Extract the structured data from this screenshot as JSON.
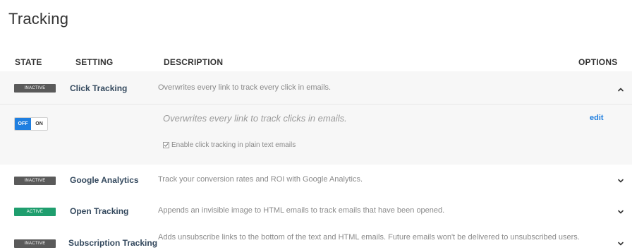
{
  "page": {
    "title": "Tracking"
  },
  "table": {
    "headers": {
      "state": "STATE",
      "setting": "SETTING",
      "description": "DESCRIPTION",
      "options": "OPTIONS"
    }
  },
  "rows": [
    {
      "state": "INACTIVE",
      "name": "Click Tracking",
      "description": "Overwrites every link to track every click in emails.",
      "chevron": "chevron-up-icon"
    },
    {
      "state": "INACTIVE",
      "name": "Google Analytics",
      "description": "Track your conversion rates and ROI with Google Analytics.",
      "chevron": "chevron-down-icon"
    },
    {
      "state": "ACTIVE",
      "name": "Open Tracking",
      "description": "Appends an invisible image to HTML emails to track emails that have been opened.",
      "chevron": "chevron-down-icon"
    },
    {
      "state": "INACTIVE",
      "name": "Subscription Tracking",
      "description": "Adds unsubscribe links to the bottom of the text and HTML emails. Future emails won't be delivered to unsubscribed users.",
      "chevron": "chevron-down-icon"
    }
  ],
  "click_tracking_detail": {
    "toggle_off": "OFF",
    "toggle_on": "ON",
    "summary": "Overwrites every link to track clicks in emails.",
    "edit": "edit",
    "checkbox_checked": true,
    "checkbox_label": "Enable click tracking in plain text emails"
  },
  "colors": {
    "inactive_badge": "#5a5a5a",
    "active_badge": "#1f9e6e",
    "accent_blue": "#1f7fe0",
    "setting_text": "#34495e"
  }
}
